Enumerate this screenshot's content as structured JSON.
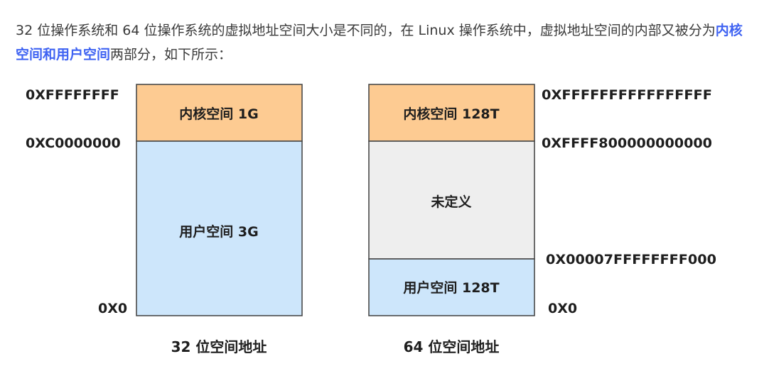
{
  "paragraph": {
    "before": "32 位操作系统和 64 位操作系统的虚拟地址空间大小是不同的，在 Linux 操作系统中，虚拟地址空间的内部又被分为",
    "highlight": "内核空间和用户空间",
    "after": "两部分，如下所示："
  },
  "diagram_32": {
    "caption": "32 位空间地址",
    "kernel_label": "内核空间 1G",
    "user_label": "用户空间 3G",
    "addr_top": "0XFFFFFFFF",
    "addr_split": "0XC0000000",
    "addr_bottom": "0X0"
  },
  "diagram_64": {
    "caption": "64 位空间地址",
    "kernel_label": "内核空间 128T",
    "undefined_label": "未定义",
    "user_label": "用户空间 128T",
    "addr_top": "0XFFFFFFFFFFFFFFFF",
    "addr_kernel_start": "0XFFFF800000000000",
    "addr_user_end": "0X00007FFFFFFFF000",
    "addr_bottom": "0X0"
  },
  "colors": {
    "kernel": "#fdcb92",
    "user": "#cde6fb",
    "undefined": "#eeeeee",
    "border": "#4a4a4a",
    "highlight": "#3f63f2"
  }
}
